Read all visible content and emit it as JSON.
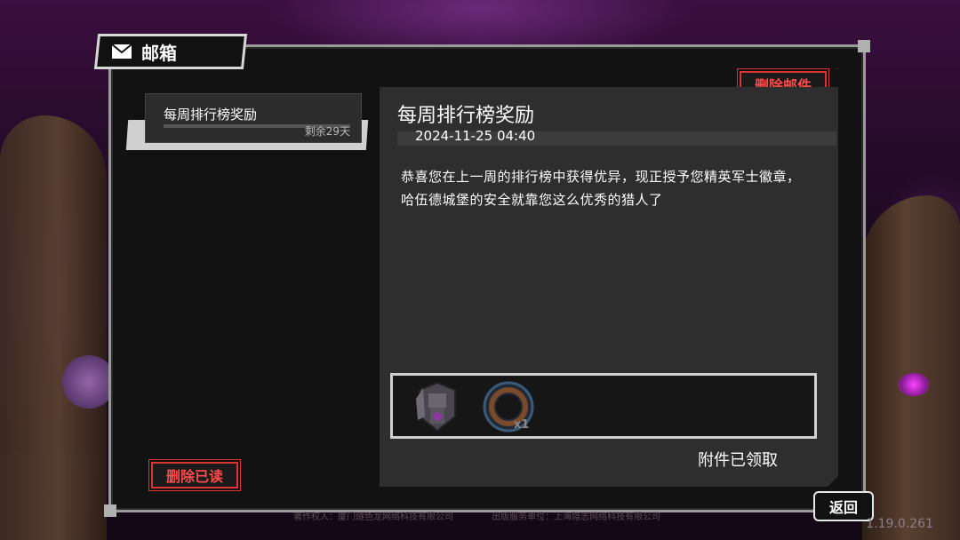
{
  "header": {
    "title": "邮箱",
    "icon": "envelope-icon"
  },
  "mail_list": [
    {
      "subject": "每周排行榜奖励",
      "remaining": "剩余29天",
      "selected": true
    }
  ],
  "actions": {
    "delete_read": "删除已读",
    "delete_mail": "删除邮件",
    "back": "返回"
  },
  "detail": {
    "subject": "每周排行榜奖励",
    "datetime": "2024-11-25 04:40",
    "body": "恭喜您在上一周的排行榜中获得优异，现正授予您精英军士徽章，哈伍德城堡的安全就靠您这么优秀的猎人了",
    "attachments": [
      {
        "icon": "elite-sergeant-badge-icon"
      },
      {
        "icon": "leather-ring-icon",
        "quantity": "x1"
      }
    ],
    "status": "附件已领取"
  },
  "footer": {
    "copyright_holder": "著作权人：厦门燧色龙网络科技有限公司",
    "publisher": "出版服务单位：上海隐志网络科技有限公司",
    "version": "1.19.0.261"
  },
  "colors": {
    "accent_red": "#ff4a4a",
    "panel_bg": "#121212"
  }
}
